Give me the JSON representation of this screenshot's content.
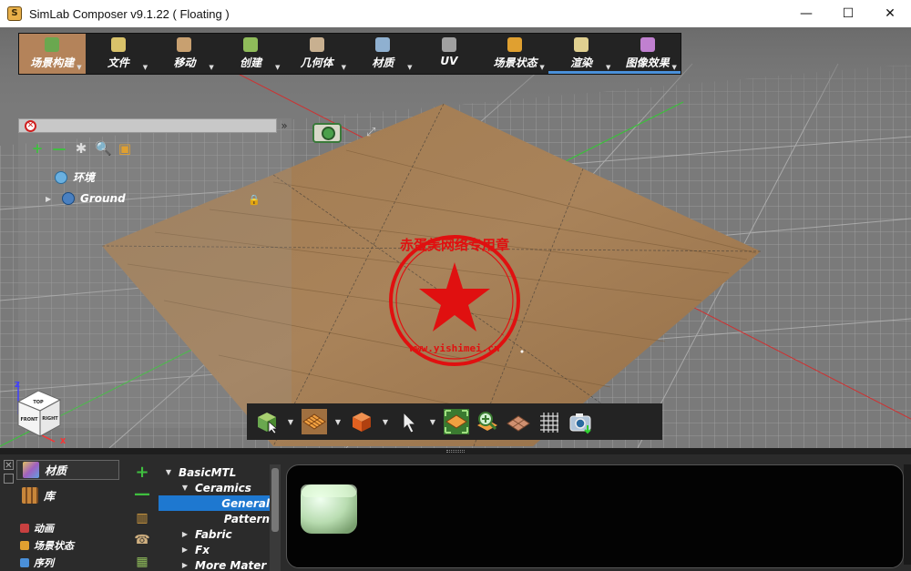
{
  "window": {
    "title": "SimLab Composer v9.1.22 ( Floating )",
    "minimize_glyph": "—",
    "maximize_glyph": "☐",
    "close_glyph": "✕"
  },
  "main_toolbar": {
    "items": [
      {
        "label": "场景构建",
        "icon": "scene-build-icon",
        "color": "#6aa84f"
      },
      {
        "label": "文件",
        "icon": "file-icon",
        "color": "#d9c26a"
      },
      {
        "label": "移动",
        "icon": "move-icon",
        "color": "#c8a070"
      },
      {
        "label": "创建",
        "icon": "create-icon",
        "color": "#8fbc5a"
      },
      {
        "label": "几何体",
        "icon": "geometry-icon",
        "color": "#c8b090"
      },
      {
        "label": "材质",
        "icon": "material-icon",
        "color": "#8fb0d0"
      },
      {
        "label": "UV",
        "icon": "uv-icon",
        "color": "#a0a0a0"
      },
      {
        "label": "场景状态",
        "icon": "scene-state-icon",
        "color": "#e0a030"
      },
      {
        "label": "渲染",
        "icon": "render-icon",
        "color": "#e0d090"
      },
      {
        "label": "图像效果",
        "icon": "image-effects-icon",
        "color": "#c080d0"
      }
    ],
    "active_index": 0,
    "arrow_glyph": "▼"
  },
  "scene_tree": {
    "search_placeholder": "",
    "clear_glyph": "✕",
    "collapse_glyph": "»",
    "tools": [
      {
        "glyph": "+",
        "color": "#3fbf3f",
        "icon": "add-icon"
      },
      {
        "glyph": "—",
        "color": "#3fbf3f",
        "icon": "remove-icon"
      },
      {
        "glyph": "✱",
        "color": "#dddddd",
        "icon": "filter-icon"
      },
      {
        "glyph": "🔍",
        "color": "#dddddd",
        "icon": "zoom-icon"
      },
      {
        "glyph": "▣",
        "color": "#e0a030",
        "icon": "group-icon"
      }
    ],
    "nodes": [
      {
        "label": "环境",
        "expander": ""
      },
      {
        "label": "Ground",
        "expander": "▶"
      }
    ],
    "lock_glyph": "🔒",
    "link_glyph": "⤢"
  },
  "nav_cube": {
    "faces": {
      "top": "TOP",
      "front": "FRONT",
      "right": "RIGHT"
    },
    "axis_z": "Z",
    "axis_x": "X"
  },
  "watermark": {
    "text": "赤蛋美网络专用章",
    "subtext": "www.yishimei.cn"
  },
  "viewport_toolbar": {
    "arrow_glyph": "▼",
    "buttons": [
      {
        "icon": "select-object-icon",
        "has_menu": true
      },
      {
        "icon": "select-face-icon",
        "has_menu": true
      },
      {
        "icon": "select-material-icon",
        "has_menu": true
      },
      {
        "icon": "pointer-icon",
        "has_menu": true
      },
      {
        "icon": "fit-all-icon",
        "has_menu": false
      },
      {
        "icon": "zoom-selected-icon",
        "has_menu": false
      },
      {
        "icon": "ground-plane-icon",
        "has_menu": false
      },
      {
        "icon": "grid-icon",
        "has_menu": false
      },
      {
        "icon": "screenshot-camera-icon",
        "has_menu": false
      }
    ]
  },
  "bottom_panel": {
    "close_glyph": "✕",
    "tabs": [
      {
        "label": "材质",
        "icon": "materials-tab-icon"
      },
      {
        "label": "库",
        "icon": "library-tab-icon"
      }
    ],
    "small_tabs": [
      {
        "label": "动画",
        "color": "#c84040"
      },
      {
        "label": "场景状态",
        "color": "#e0a030"
      },
      {
        "label": "序列",
        "color": "#4a90d9"
      }
    ],
    "material_tools": [
      {
        "glyph": "+",
        "color": "#3fbf3f",
        "icon": "add-material-icon"
      },
      {
        "glyph": "—",
        "color": "#3fbf3f",
        "icon": "remove-material-icon"
      },
      {
        "glyph": "▥",
        "color": "#d9a040",
        "icon": "material-library-icon"
      },
      {
        "glyph": "☎",
        "color": "#d0b080",
        "icon": "material-settings-icon"
      },
      {
        "glyph": "▦",
        "color": "#8fbc5a",
        "icon": "material-grid-icon"
      }
    ],
    "material_tree": [
      {
        "label": "BasicMTL",
        "expander": "▼",
        "indent": 0
      },
      {
        "label": "Ceramics",
        "expander": "▼",
        "indent": 1
      },
      {
        "label": "General",
        "expander": "",
        "indent": 2
      },
      {
        "label": "Pattern",
        "expander": "",
        "indent": 2
      },
      {
        "label": "Fabric",
        "expander": "▶",
        "indent": 1
      },
      {
        "label": "Fx",
        "expander": "▶",
        "indent": 1
      },
      {
        "label": "More Mater",
        "expander": "▶",
        "indent": 1
      }
    ],
    "selected_material_index": 2
  }
}
